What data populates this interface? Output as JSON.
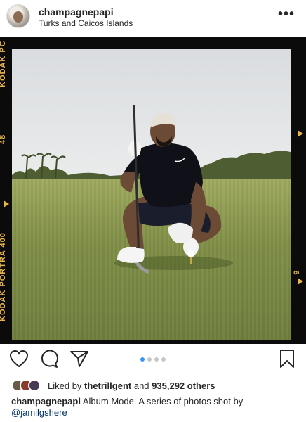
{
  "post": {
    "username": "champagnepapi",
    "location": "Turks and Caicos Islands",
    "more_label": "•••"
  },
  "photo": {
    "film_left_top": "KODAK PC",
    "film_left_number": "48",
    "film_left_bottom": "KODAK PORTRA 400",
    "film_right_number": "6",
    "film_color": "#e9b44a"
  },
  "carousel": {
    "count": 4,
    "active_index": 0
  },
  "likes": {
    "liked_by_prefix": "Liked by",
    "liked_by_user": "thetrillgent",
    "and_label": "and",
    "count_text": "935,292 others"
  },
  "caption": {
    "username": "champagnepapi",
    "text_before": "Album Mode. A series of photos shot by",
    "mention": "@jamilgshere"
  },
  "icons": [
    "more-icon",
    "heart-icon",
    "comment-icon",
    "share-icon",
    "bookmark-icon"
  ]
}
